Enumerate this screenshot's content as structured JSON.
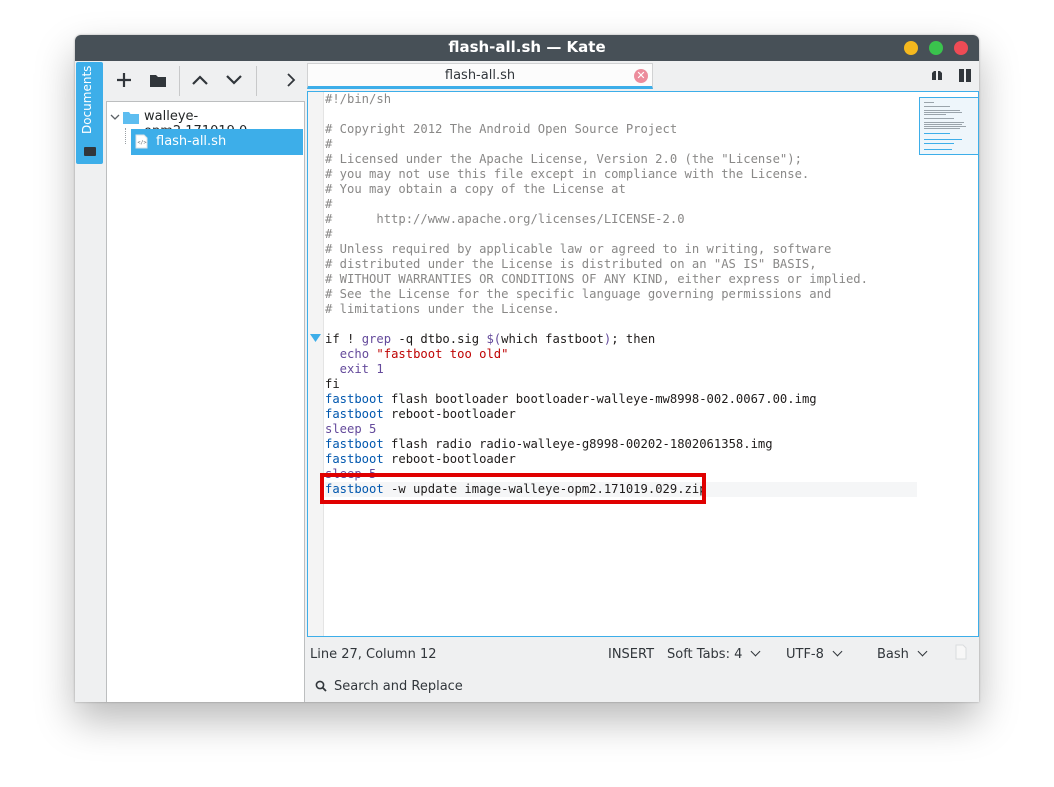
{
  "window": {
    "title": "flash-all.sh — Kate",
    "controls": [
      "minimize",
      "maximize",
      "close"
    ],
    "colors": {
      "minimize": "#f5b81e",
      "maximize": "#3ac34d",
      "close": "#ee4b55",
      "accent": "#3daee9",
      "highlight_box": "#e00000"
    }
  },
  "sidebar": {
    "tab_label": "Documents",
    "icon": "folder-icon"
  },
  "toolbar": {
    "buttons": [
      {
        "name": "new-document-button",
        "icon": "plus-icon"
      },
      {
        "name": "open-folder-button",
        "icon": "folder-icon"
      },
      {
        "name": "previous-document-button",
        "icon": "chevron-up-icon"
      },
      {
        "name": "next-document-button",
        "icon": "chevron-down-icon"
      },
      {
        "name": "expand-button",
        "icon": "chevron-right-icon"
      }
    ]
  },
  "filetree": {
    "folder": "walleye-opm2.171019.0...",
    "file": "flash-all.sh"
  },
  "tabs": [
    {
      "label": "flash-all.sh",
      "active": true
    }
  ],
  "editor": {
    "lines": [
      "#!/bin/sh",
      "",
      "# Copyright 2012 The Android Open Source Project",
      "#",
      "# Licensed under the Apache License, Version 2.0 (the \"License\");",
      "# you may not use this file except in compliance with the License.",
      "# You may obtain a copy of the License at",
      "#",
      "#      http://www.apache.org/licenses/LICENSE-2.0",
      "#",
      "# Unless required by applicable law or agreed to in writing, software",
      "# distributed under the License is distributed on an \"AS IS\" BASIS,",
      "# WITHOUT WARRANTIES OR CONDITIONS OF ANY KIND, either express or implied.",
      "# See the License for the specific language governing permissions and",
      "# limitations under the License.",
      "",
      "if ! grep -q dtbo.sig $(which fastboot); then",
      "  echo \"fastboot too old\"",
      "  exit 1",
      "fi",
      "fastboot flash bootloader bootloader-walleye-mw8998-002.0067.00.img",
      "fastboot reboot-bootloader",
      "sleep 5",
      "fastboot flash radio radio-walleye-g8998-00202-1802061358.img",
      "fastboot reboot-bootloader",
      "sleep 5",
      "fastboot -w update image-walleye-opm2.171019.029.zip"
    ]
  },
  "statusbar": {
    "position": "Line 27, Column 12",
    "mode": "INSERT",
    "indent": "Soft Tabs: 4",
    "encoding": "UTF-8",
    "syntax": "Bash"
  },
  "searchbar": {
    "label": "Search and Replace",
    "icon": "search-icon"
  }
}
